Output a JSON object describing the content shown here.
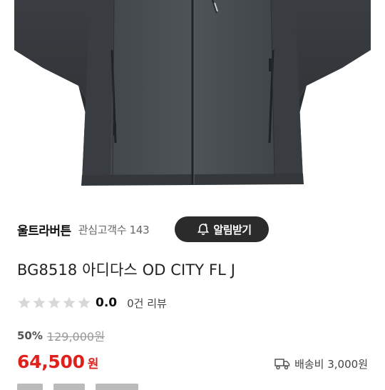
{
  "store": {
    "name": "울트라버튼",
    "followers": "관심고객수 143",
    "alarm_label": "알림받기"
  },
  "product": {
    "title": "BG8518 아디다스 OD CITY FL J",
    "rating": "0.0",
    "rating_stars": 0,
    "review_count": "0건 리뷰",
    "discount": "50%",
    "original_price": "129,000원",
    "price": "64,500",
    "currency": "원",
    "shipping": "배송비 3,000원",
    "image_icon": "jacket-photo"
  },
  "colors": {
    "price": "#e0201c",
    "alarm_button": "#2b2b2b",
    "star_empty": "#d8d8d8"
  }
}
